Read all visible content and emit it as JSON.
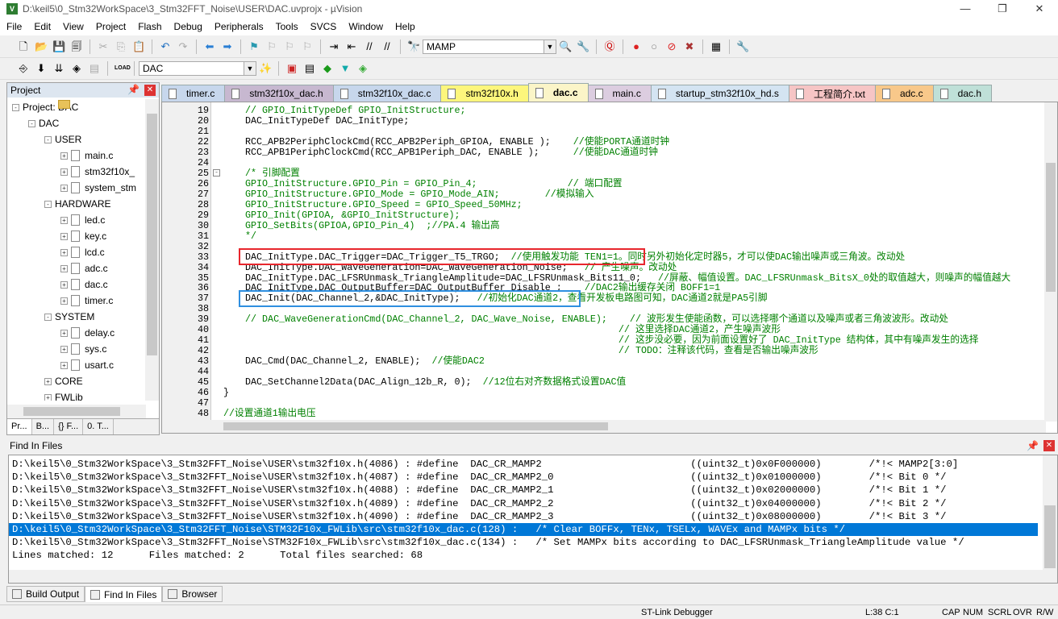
{
  "title": "D:\\keil5\\0_Stm32WorkSpace\\3_Stm32FFT_Noise\\USER\\DAC.uvprojx - µVision",
  "window_controls": {
    "minimize": "—",
    "maximize": "❐",
    "close": "✕"
  },
  "menu": [
    "File",
    "Edit",
    "View",
    "Project",
    "Flash",
    "Debug",
    "Peripherals",
    "Tools",
    "SVCS",
    "Window",
    "Help"
  ],
  "toolbar1": {
    "find_value": "MAMP"
  },
  "toolbar2": {
    "load_label": "LOAD",
    "target_value": "DAC"
  },
  "project": {
    "title": "Project",
    "tree": [
      {
        "label": "Project: DAC",
        "level": 0,
        "kind": "root",
        "exp": "-"
      },
      {
        "label": "DAC",
        "level": 1,
        "kind": "folder",
        "exp": "-"
      },
      {
        "label": "USER",
        "level": 2,
        "kind": "folder",
        "exp": "-"
      },
      {
        "label": "main.c",
        "level": 3,
        "kind": "file",
        "exp": "+"
      },
      {
        "label": "stm32f10x_",
        "level": 3,
        "kind": "file",
        "exp": "+"
      },
      {
        "label": "system_stm",
        "level": 3,
        "kind": "file",
        "exp": "+"
      },
      {
        "label": "HARDWARE",
        "level": 2,
        "kind": "folder",
        "exp": "-"
      },
      {
        "label": "led.c",
        "level": 3,
        "kind": "file",
        "exp": "+"
      },
      {
        "label": "key.c",
        "level": 3,
        "kind": "file",
        "exp": "+"
      },
      {
        "label": "lcd.c",
        "level": 3,
        "kind": "file",
        "exp": "+"
      },
      {
        "label": "adc.c",
        "level": 3,
        "kind": "file",
        "exp": "+"
      },
      {
        "label": "dac.c",
        "level": 3,
        "kind": "file",
        "exp": "+"
      },
      {
        "label": "timer.c",
        "level": 3,
        "kind": "file",
        "exp": "+"
      },
      {
        "label": "SYSTEM",
        "level": 2,
        "kind": "folder",
        "exp": "-"
      },
      {
        "label": "delay.c",
        "level": 3,
        "kind": "file",
        "exp": "+"
      },
      {
        "label": "sys.c",
        "level": 3,
        "kind": "file",
        "exp": "+"
      },
      {
        "label": "usart.c",
        "level": 3,
        "kind": "file",
        "exp": "+"
      },
      {
        "label": "CORE",
        "level": 2,
        "kind": "folder",
        "exp": "+"
      },
      {
        "label": "FWLib",
        "level": 2,
        "kind": "folder",
        "exp": "+"
      }
    ],
    "tabs": [
      "Pr...",
      "B...",
      "{} F...",
      "0. T..."
    ]
  },
  "tabs": [
    {
      "label": "timer.c",
      "color": "#c7d7ec"
    },
    {
      "label": "stm32f10x_dac.h",
      "color": "#c7b8d0"
    },
    {
      "label": "stm32f10x_dac.c",
      "color": "#c7d7ec"
    },
    {
      "label": "stm32f10x.h",
      "color": "#fdf67c"
    },
    {
      "label": "dac.c",
      "color": "#fbf5c8",
      "active": true
    },
    {
      "label": "main.c",
      "color": "#dccde0"
    },
    {
      "label": "startup_stm32f10x_hd.s",
      "color": "#d4e4f2"
    },
    {
      "label": "工程简介.txt",
      "color": "#f6c5c5"
    },
    {
      "label": "adc.c",
      "color": "#f8c88a"
    },
    {
      "label": "dac.h",
      "color": "#bfe0d8"
    }
  ],
  "code": [
    {
      "n": "19",
      "code": "",
      "comment": "// GPIO_InitTypeDef GPIO_InitStructure;"
    },
    {
      "n": "20",
      "code": "DAC_InitTypeDef DAC_InitType;",
      "comment": ""
    },
    {
      "n": "21",
      "code": "",
      "comment": ""
    },
    {
      "n": "22",
      "code": "RCC_APB2PeriphClockCmd(RCC_APB2Periph_GPIOA, ENABLE );    ",
      "comment": "//使能PORTA通道时钟"
    },
    {
      "n": "23",
      "code": "RCC_APB1PeriphClockCmd(RCC_APB1Periph_DAC, ENABLE );      ",
      "comment": "//使能DAC通道时钟"
    },
    {
      "n": "24",
      "code": "",
      "comment": ""
    },
    {
      "n": "25",
      "code": "",
      "comment": "/* 引脚配置",
      "fold": "-"
    },
    {
      "n": "26",
      "code": "",
      "comment": "GPIO_InitStructure.GPIO_Pin = GPIO_Pin_4;                // 端口配置"
    },
    {
      "n": "27",
      "code": "",
      "comment": "GPIO_InitStructure.GPIO_Mode = GPIO_Mode_AIN;        //模拟输入"
    },
    {
      "n": "28",
      "code": "",
      "comment": "GPIO_InitStructure.GPIO_Speed = GPIO_Speed_50MHz;"
    },
    {
      "n": "29",
      "code": "",
      "comment": "GPIO_Init(GPIOA, &GPIO_InitStructure);"
    },
    {
      "n": "30",
      "code": "",
      "comment": "GPIO_SetBits(GPIOA,GPIO_Pin_4)  ;//PA.4 输出高"
    },
    {
      "n": "31",
      "code": "",
      "comment": "*/"
    },
    {
      "n": "32",
      "code": "",
      "comment": ""
    },
    {
      "n": "33",
      "code": "DAC_InitType.DAC_Trigger=DAC_Trigger_T5_TRGO;  ",
      "comment": "//使用触发功能 TEN1=1。同时另外初始化定时器5，才可以使DAC输出噪声或三角波。改动处"
    },
    {
      "n": "34",
      "code": "DAC_InitType.DAC_WaveGeneration=DAC_WaveGeneration_Noise;   ",
      "comment": "// 产生噪声。改动处"
    },
    {
      "n": "35",
      "code": "DAC_InitType.DAC_LFSRUnmask_TriangleAmplitude=DAC_LFSRUnmask_Bits11_0;   ",
      "comment": "//屏蔽、幅值设置。DAC_LFSRUnmask_BitsX_0处的取值越大，则噪声的幅值越大"
    },
    {
      "n": "36",
      "code": "DAC_InitType.DAC_OutputBuffer=DAC_OutputBuffer_Disable ;    ",
      "comment": "//DAC2输出缓存关闭 BOFF1=1"
    },
    {
      "n": "37",
      "code": "DAC_Init(DAC_Channel_2,&DAC_InitType);   ",
      "comment": "//初始化DAC通道2，查看开发板电路图可知，DAC通道2就是PA5引脚"
    },
    {
      "n": "38",
      "code": "",
      "comment": ""
    },
    {
      "n": "39",
      "code": "",
      "comment": "// DAC_WaveGenerationCmd(DAC_Channel_2, DAC_Wave_Noise, ENABLE);    // 波形发生使能函数，可以选择哪个通道以及噪声或者三角波波形。改动处"
    },
    {
      "n": "40",
      "code": "",
      "comment": "                                                                  // 这里选择DAC通道2，产生噪声波形"
    },
    {
      "n": "41",
      "code": "",
      "comment": "                                                                  // 这步没必要，因为前面设置好了 DAC_InitType 结构体，其中有噪声发生的选择"
    },
    {
      "n": "42",
      "code": "",
      "comment": "                                                                  // TODO：注释该代码，查看是否输出噪声波形"
    },
    {
      "n": "43",
      "code": "DAC_Cmd(DAC_Channel_2, ENABLE);  ",
      "comment": "//使能DAC2"
    },
    {
      "n": "44",
      "code": "",
      "comment": ""
    },
    {
      "n": "45",
      "code": "DAC_SetChannel2Data(DAC_Align_12b_R, 0);  ",
      "comment": "//12位右对齐数据格式设置DAC值"
    },
    {
      "n": "46",
      "code": "}",
      "comment": "",
      "outdent": true
    },
    {
      "n": "47",
      "code": "",
      "comment": ""
    },
    {
      "n": "48",
      "code": "",
      "comment": "//设置通道1输出电压",
      "outdent": true
    }
  ],
  "find": {
    "title": "Find In Files",
    "lines": [
      "D:\\keil5\\0_Stm32WorkSpace\\3_Stm32FFT_Noise\\USER\\stm32f10x.h(4086) : #define  DAC_CR_MAMP2                         ((uint32_t)0x0F000000)        /*!< MAMP2[3:0]",
      "D:\\keil5\\0_Stm32WorkSpace\\3_Stm32FFT_Noise\\USER\\stm32f10x.h(4087) : #define  DAC_CR_MAMP2_0                       ((uint32_t)0x01000000)        /*!< Bit 0 */",
      "D:\\keil5\\0_Stm32WorkSpace\\3_Stm32FFT_Noise\\USER\\stm32f10x.h(4088) : #define  DAC_CR_MAMP2_1                       ((uint32_t)0x02000000)        /*!< Bit 1 */",
      "D:\\keil5\\0_Stm32WorkSpace\\3_Stm32FFT_Noise\\USER\\stm32f10x.h(4089) : #define  DAC_CR_MAMP2_2                       ((uint32_t)0x04000000)        /*!< Bit 2 */",
      "D:\\keil5\\0_Stm32WorkSpace\\3_Stm32FFT_Noise\\USER\\stm32f10x.h(4090) : #define  DAC_CR_MAMP2_3                       ((uint32_t)0x08000000)        /*!< Bit 3 */",
      "D:\\keil5\\0_Stm32WorkSpace\\3_Stm32FFT_Noise\\STM32F10x_FWLib\\src\\stm32f10x_dac.c(128) :   /* Clear BOFFx, TENx, TSELx, WAVEx and MAMPx bits */",
      "D:\\keil5\\0_Stm32WorkSpace\\3_Stm32FFT_Noise\\STM32F10x_FWLib\\src\\stm32f10x_dac.c(134) :   /* Set MAMPx bits according to DAC_LFSRUnmask_TriangleAmplitude value */",
      "Lines matched: 12      Files matched: 2      Total files searched: 68"
    ],
    "selected_index": 5
  },
  "bottom_tabs": [
    "Build Output",
    "Find In Files",
    "Browser"
  ],
  "status": {
    "debugger": "ST-Link Debugger",
    "position": "L:38 C:1",
    "caps": "CAP",
    "num": "NUM",
    "scrl": "SCRL",
    "ovr": "OVR",
    "rw": "R/W"
  },
  "colors": {
    "comment": "#008000",
    "selection": "#0078d7",
    "trigger_box": "#e8262d",
    "init_box": "#2f8fe0"
  }
}
